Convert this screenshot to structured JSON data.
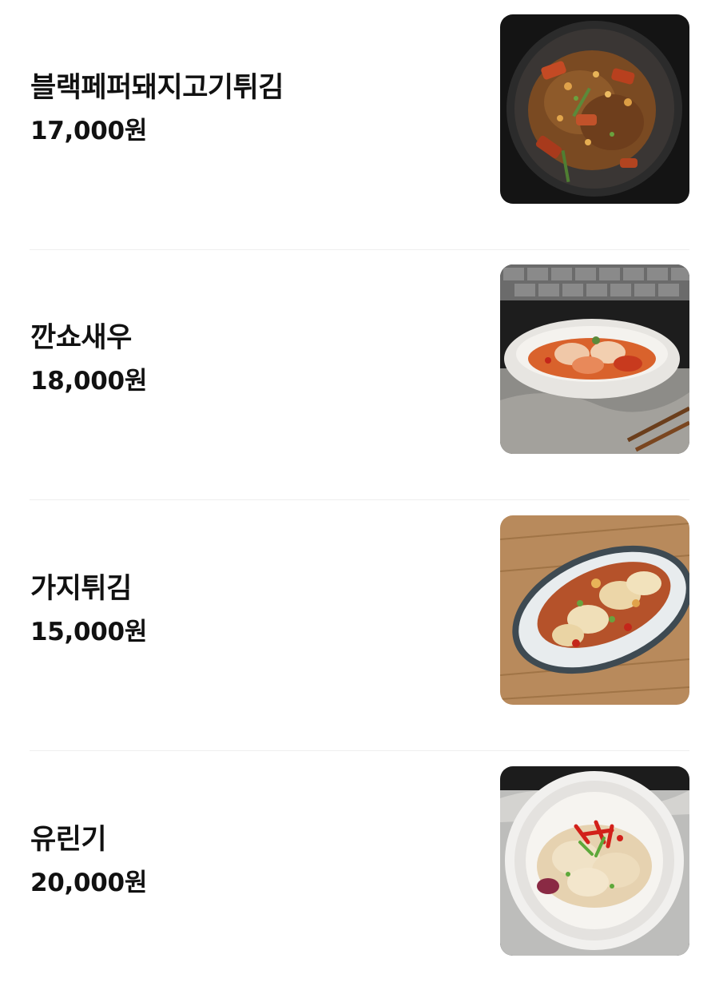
{
  "menu": {
    "items": [
      {
        "name": "블랙페퍼돼지고기튀김",
        "price": "17,000원",
        "photo_icon": "dish-photo-icon"
      },
      {
        "name": "깐쇼새우",
        "price": "18,000원",
        "photo_icon": "dish-photo-icon"
      },
      {
        "name": "가지튀김",
        "price": "15,000원",
        "photo_icon": "dish-photo-icon"
      },
      {
        "name": "유린기",
        "price": "20,000원",
        "photo_icon": "dish-photo-icon"
      }
    ]
  },
  "colors": {
    "text": "#111111",
    "divider": "#eeeeee",
    "background": "#ffffff"
  }
}
